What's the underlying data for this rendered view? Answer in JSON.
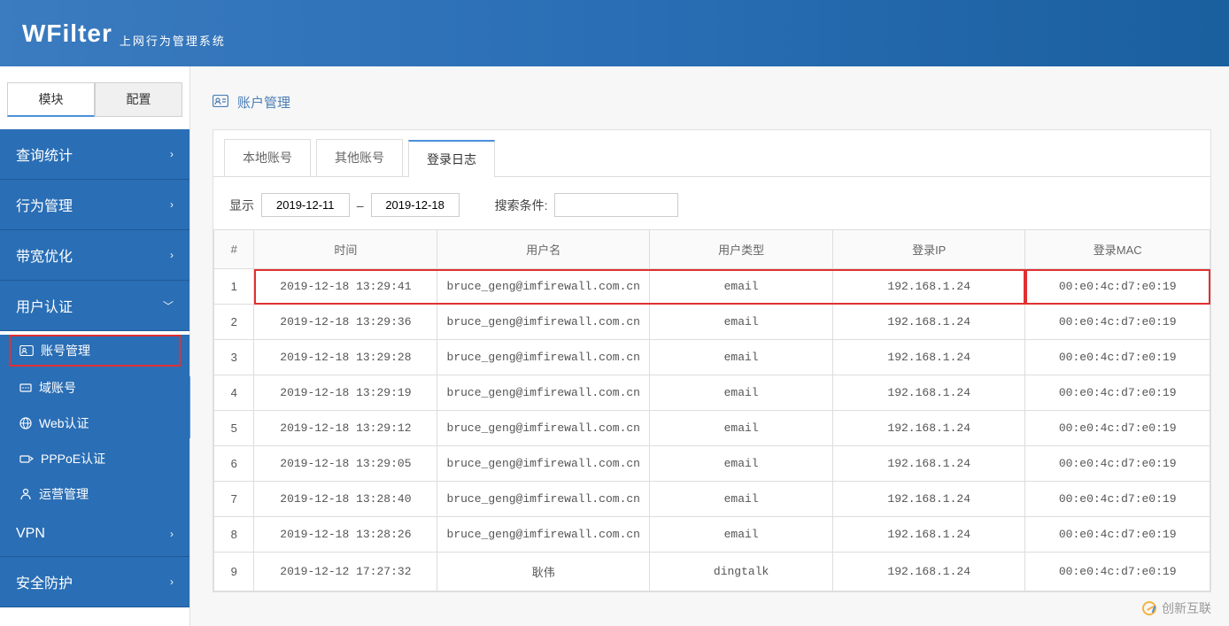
{
  "header": {
    "brand": "WFilter",
    "sub_brand": "上网行为管理系统"
  },
  "sidebar": {
    "tabs": [
      {
        "label": "模块",
        "active": true
      },
      {
        "label": "配置",
        "active": false
      }
    ],
    "menu": [
      {
        "label": "查询统计",
        "expanded": false
      },
      {
        "label": "行为管理",
        "expanded": false
      },
      {
        "label": "带宽优化",
        "expanded": false
      },
      {
        "label": "用户认证",
        "expanded": true,
        "children": [
          {
            "label": "账号管理",
            "icon": "id-card",
            "active": true
          },
          {
            "label": "域账号",
            "icon": "domain",
            "active": false
          },
          {
            "label": "Web认证",
            "icon": "globe",
            "active": false
          },
          {
            "label": "PPPoE认证",
            "icon": "pppoe",
            "active": false
          },
          {
            "label": "运营管理",
            "icon": "operate",
            "active": false
          }
        ]
      },
      {
        "label": "VPN",
        "expanded": false
      },
      {
        "label": "安全防护",
        "expanded": false
      }
    ]
  },
  "breadcrumb": {
    "title": "账户管理"
  },
  "inner_tabs": [
    {
      "label": "本地账号",
      "active": false
    },
    {
      "label": "其他账号",
      "active": false
    },
    {
      "label": "登录日志",
      "active": true
    }
  ],
  "filter": {
    "show_label": "显示",
    "date_from": "2019-12-11",
    "date_sep": "–",
    "date_to": "2019-12-18",
    "search_label": "搜索条件:",
    "search_value": ""
  },
  "table": {
    "columns": [
      "#",
      "时间",
      "用户名",
      "用户类型",
      "登录IP",
      "登录MAC"
    ],
    "rows": [
      {
        "idx": "1",
        "time": "2019-12-18 13:29:41",
        "user": "bruce_geng@imfirewall.com.cn",
        "type": "email",
        "ip": "192.168.1.24",
        "mac": "00:e0:4c:d7:e0:19",
        "highlight": true
      },
      {
        "idx": "2",
        "time": "2019-12-18 13:29:36",
        "user": "bruce_geng@imfirewall.com.cn",
        "type": "email",
        "ip": "192.168.1.24",
        "mac": "00:e0:4c:d7:e0:19"
      },
      {
        "idx": "3",
        "time": "2019-12-18 13:29:28",
        "user": "bruce_geng@imfirewall.com.cn",
        "type": "email",
        "ip": "192.168.1.24",
        "mac": "00:e0:4c:d7:e0:19"
      },
      {
        "idx": "4",
        "time": "2019-12-18 13:29:19",
        "user": "bruce_geng@imfirewall.com.cn",
        "type": "email",
        "ip": "192.168.1.24",
        "mac": "00:e0:4c:d7:e0:19"
      },
      {
        "idx": "5",
        "time": "2019-12-18 13:29:12",
        "user": "bruce_geng@imfirewall.com.cn",
        "type": "email",
        "ip": "192.168.1.24",
        "mac": "00:e0:4c:d7:e0:19"
      },
      {
        "idx": "6",
        "time": "2019-12-18 13:29:05",
        "user": "bruce_geng@imfirewall.com.cn",
        "type": "email",
        "ip": "192.168.1.24",
        "mac": "00:e0:4c:d7:e0:19"
      },
      {
        "idx": "7",
        "time": "2019-12-18 13:28:40",
        "user": "bruce_geng@imfirewall.com.cn",
        "type": "email",
        "ip": "192.168.1.24",
        "mac": "00:e0:4c:d7:e0:19"
      },
      {
        "idx": "8",
        "time": "2019-12-18 13:28:26",
        "user": "bruce_geng@imfirewall.com.cn",
        "type": "email",
        "ip": "192.168.1.24",
        "mac": "00:e0:4c:d7:e0:19"
      },
      {
        "idx": "9",
        "time": "2019-12-12 17:27:32",
        "user": "耿伟",
        "type": "dingtalk",
        "ip": "192.168.1.24",
        "mac": "00:e0:4c:d7:e0:19"
      }
    ]
  },
  "watermark": "创新互联"
}
